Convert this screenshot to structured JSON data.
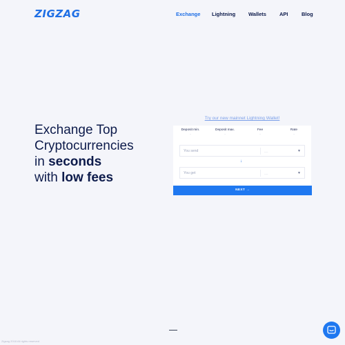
{
  "brand": {
    "logo": "ZIGZAG",
    "accent": "#1f6fe5",
    "button_color": "#1f78f0",
    "text_color": "#0d1b4b"
  },
  "nav": {
    "items": [
      {
        "label": "Exchange",
        "active": true
      },
      {
        "label": "Lightning",
        "active": false
      },
      {
        "label": "Wallets",
        "active": false
      },
      {
        "label": "API",
        "active": false
      },
      {
        "label": "Blog",
        "active": false
      }
    ]
  },
  "hero": {
    "line1": "Exchange Top",
    "line2": "Cryptocurrencies",
    "line3_prefix": "in ",
    "line3_bold": "seconds",
    "line4_prefix": "with ",
    "line4_bold": "low fees"
  },
  "widget": {
    "promo_link": "Try our new mainnet Lightning Wallet!",
    "stats": [
      {
        "label": "Deposit min.",
        "value": "-"
      },
      {
        "label": "Deposit max.",
        "value": "-"
      },
      {
        "label": "Fee",
        "value": "-"
      },
      {
        "label": "Rate",
        "value": "-"
      }
    ],
    "send": {
      "label": "You send",
      "currency": "----",
      "chevron_icon": "chevron-down-icon"
    },
    "swap_icon": "arrow-down-icon",
    "get": {
      "label": "You get",
      "currency": "----",
      "chevron_icon": "chevron-down-icon"
    },
    "next_label": "NEXT →"
  },
  "footer": {
    "copyright": "Zigzag 2018 All rights reserved"
  },
  "chat_icon": "chat-bubble-icon"
}
